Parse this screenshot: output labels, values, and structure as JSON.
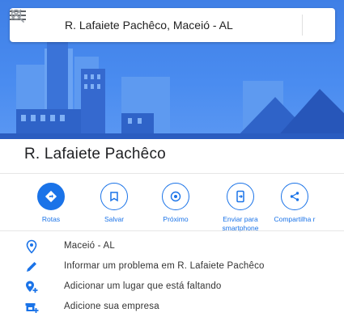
{
  "search": {
    "query": "R. Lafaiete Pachêco, Maceió - AL"
  },
  "place": {
    "title": "R. Lafaiete Pachêco"
  },
  "actions": [
    {
      "label": "Rotas",
      "icon": "directions-icon"
    },
    {
      "label": "Salvar",
      "icon": "bookmark-icon"
    },
    {
      "label": "Próximo",
      "icon": "nearby-icon"
    },
    {
      "label": "Enviar para smartphone",
      "icon": "send-to-phone-icon"
    },
    {
      "label": "Compartilha r",
      "icon": "share-icon"
    }
  ],
  "details": [
    {
      "text": "Maceió - AL",
      "icon": "location-pin-icon"
    },
    {
      "text": "Informar um problema em R. Lafaiete Pachêco",
      "icon": "edit-pencil-icon"
    },
    {
      "text": "Adicionar um lugar que está faltando",
      "icon": "add-place-icon"
    },
    {
      "text": "Adicione sua empresa",
      "icon": "add-business-icon"
    }
  ],
  "colors": {
    "accent": "#1a73e8",
    "hero": "#4a8cf0"
  }
}
